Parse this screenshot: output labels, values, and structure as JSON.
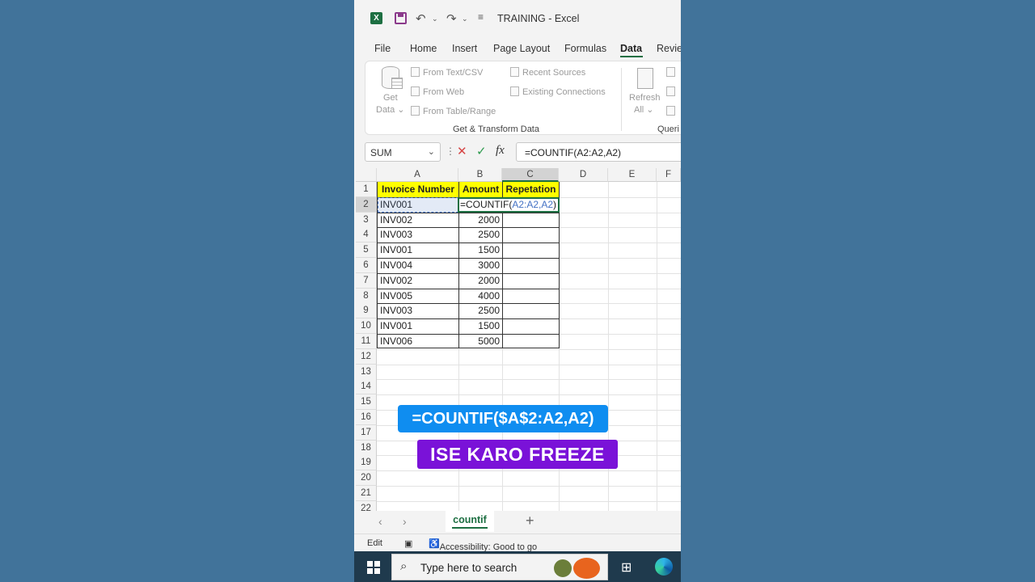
{
  "window": {
    "title": "TRAINING  -  Excel"
  },
  "menu": [
    "File",
    "Home",
    "Insert",
    "Page Layout",
    "Formulas",
    "Data",
    "Revie"
  ],
  "ribbon": {
    "get_data": "Get",
    "get_data2": "Data",
    "from_text": "From Text/CSV",
    "from_web": "From Web",
    "from_table": "From Table/Range",
    "recent_sources": "Recent Sources",
    "existing_connections": "Existing Connections",
    "group_label": "Get & Transform Data",
    "refresh": "Refresh",
    "refresh2": "All",
    "queries": "Queri"
  },
  "formula_bar": {
    "name_box": "SUM",
    "fx": "fx",
    "formula": "=COUNTIF(A2:A2,A2)"
  },
  "columns": [
    "A",
    "B",
    "C",
    "D",
    "E",
    "F"
  ],
  "rows": [
    "1",
    "2",
    "3",
    "4",
    "5",
    "6",
    "7",
    "8",
    "9",
    "10",
    "11",
    "12",
    "13",
    "14",
    "15",
    "16",
    "17",
    "18",
    "19",
    "20",
    "21",
    "22"
  ],
  "table": {
    "headers": [
      "Invoice Number",
      "Amount",
      "Repetation"
    ],
    "data": [
      [
        "INV001",
        ""
      ],
      [
        "INV002",
        "2000"
      ],
      [
        "INV003",
        "2500"
      ],
      [
        "INV001",
        "1500"
      ],
      [
        "INV004",
        "3000"
      ],
      [
        "INV002",
        "2000"
      ],
      [
        "INV005",
        "4000"
      ],
      [
        "INV003",
        "2500"
      ],
      [
        "INV001",
        "1500"
      ],
      [
        "INV006",
        "5000"
      ]
    ]
  },
  "edit_cell": {
    "prefix": "=COUNTIF(",
    "ref": "A2:A2,A2",
    "suffix": ")"
  },
  "overlays": {
    "formula": "=COUNTIF($A$2:A2,A2)",
    "caption": "ISE KARO FREEZE"
  },
  "sheet_tab": "countif",
  "status": {
    "mode": "Edit",
    "accessibility": "Accessibility: Good to go"
  },
  "taskbar": {
    "search_placeholder": "Type here to search"
  }
}
